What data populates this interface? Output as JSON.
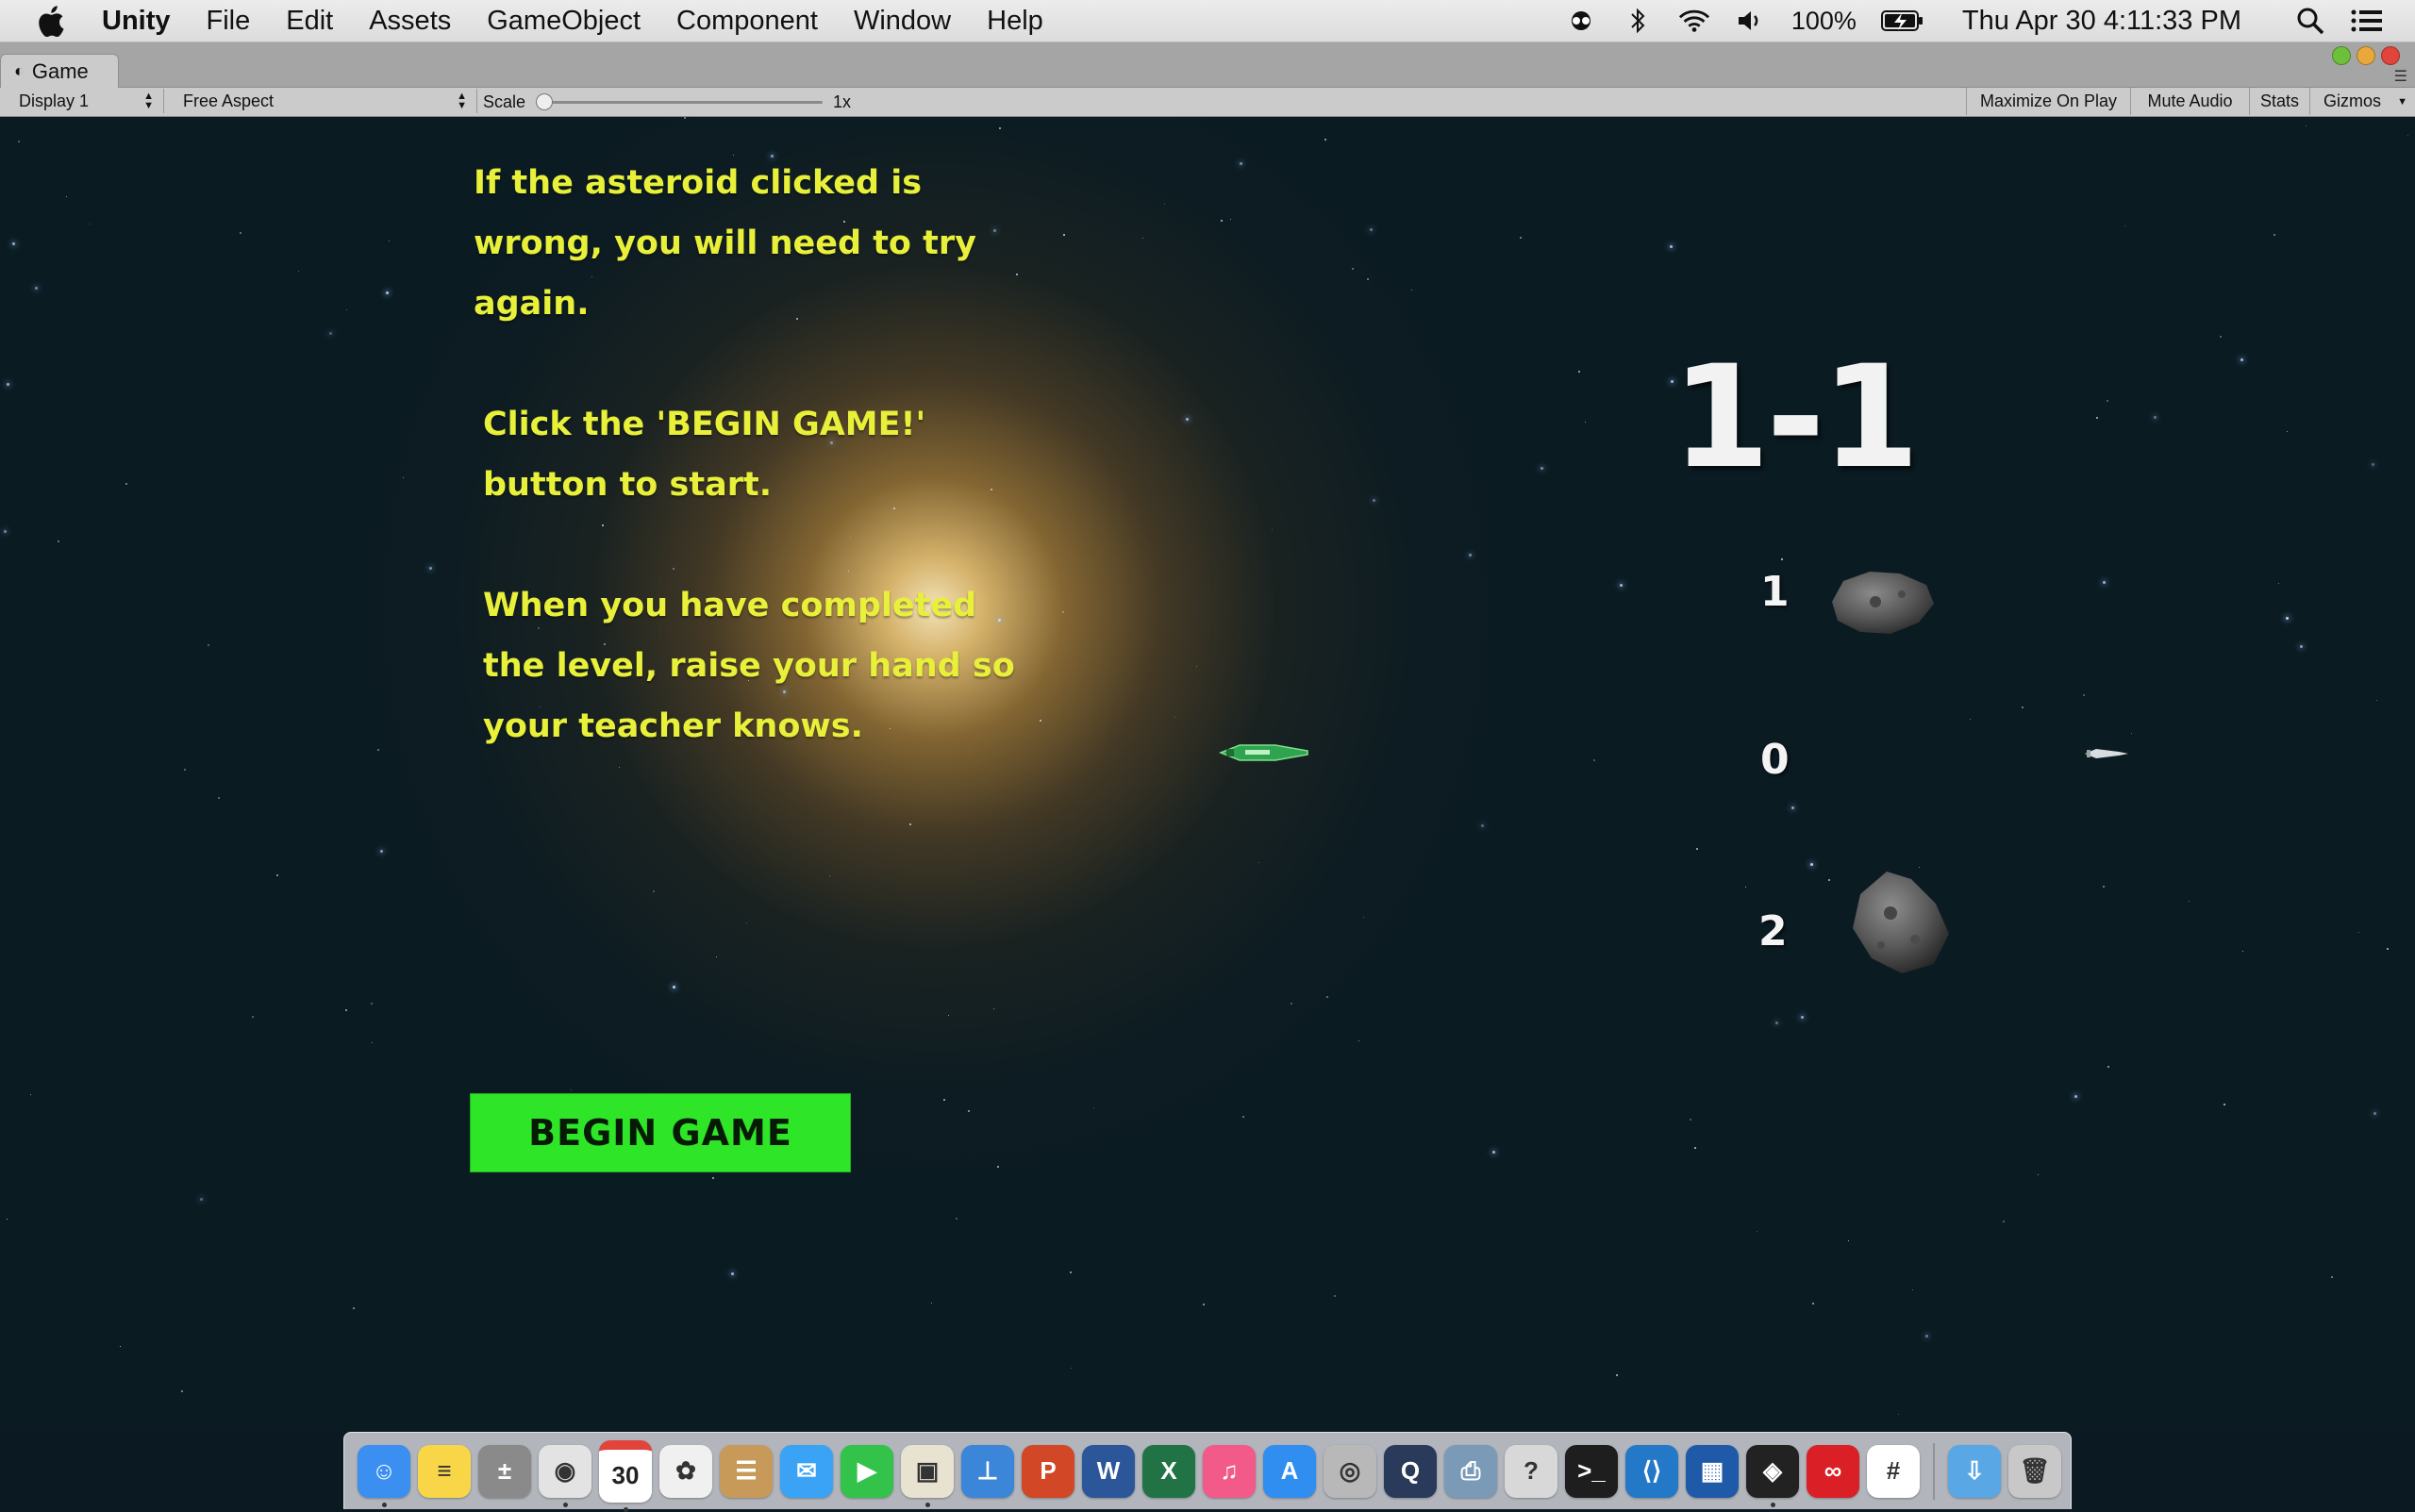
{
  "menubar": {
    "app_name": "Unity",
    "menus": [
      "File",
      "Edit",
      "Assets",
      "GameObject",
      "Component",
      "Window",
      "Help"
    ],
    "battery": "100%",
    "datetime": "Thu Apr 30  4:11:33 PM",
    "icons": [
      "apple-icon",
      "glasses-icon",
      "bluetooth-icon",
      "wifi-icon",
      "volume-icon",
      "battery-icon",
      "search-icon",
      "list-icon"
    ]
  },
  "tab": {
    "label": "Game",
    "icon": "unity-icon"
  },
  "toolbar": {
    "display": "Display 1",
    "aspect": "Free Aspect",
    "scale_label": "Scale",
    "scale_value": "1x",
    "buttons": [
      "Maximize On Play",
      "Mute Audio",
      "Stats",
      "Gizmos"
    ]
  },
  "game": {
    "instructions": [
      "If the asteroid clicked is wrong, you will need to try again.",
      "Click the 'BEGIN GAME!' button to start.",
      "When you have completed the level, raise your hand so your teacher knows."
    ],
    "level": "1-1",
    "answers": [
      "1",
      "0",
      "2"
    ],
    "begin_button": "BEGIN GAME"
  },
  "dock": {
    "apps": [
      "Finder",
      "Notes",
      "Calculator",
      "Chrome",
      "Calendar",
      "Photos",
      "Contacts",
      "Messages",
      "FaceTime",
      "Preview",
      "Keynote",
      "PowerPoint",
      "Word",
      "Excel",
      "iTunes",
      "App Store",
      "Disk Utility",
      "QuickTime",
      "Image Capture",
      "Help",
      "Terminal",
      "VS Code",
      "VirtualBox",
      "Unity",
      "Creative Cloud",
      "Slack",
      "Downloads",
      "Trash"
    ],
    "calendar_day": "30",
    "colors": {
      "Finder": "#3a8ff0",
      "Notes": "#f8d648",
      "Calculator": "#8a8a8a",
      "Chrome": "#e3e3e3",
      "Calendar": "#ffffff",
      "Photos": "#f0f0f0",
      "Contacts": "#c89a5a",
      "Messages": "#3aa3f5",
      "FaceTime": "#33c24a",
      "Preview": "#e8e2d0",
      "Keynote": "#3b86d8",
      "PowerPoint": "#d24726",
      "Word": "#2b579a",
      "Excel": "#217346",
      "iTunes": "#f25a8a",
      "App Store": "#2f8ef0",
      "Disk Utility": "#b8b8b8",
      "QuickTime": "#2a3a5a",
      "Image Capture": "#7a9ab8",
      "Help": "#d8d8d8",
      "Terminal": "#1e1e1e",
      "VS Code": "#2378c8",
      "VirtualBox": "#1e5aa8",
      "Unity": "#222222",
      "Creative Cloud": "#da1f26",
      "Slack": "#ffffff",
      "Downloads": "#5aa7e6",
      "Trash": "#c8c8c8"
    }
  }
}
